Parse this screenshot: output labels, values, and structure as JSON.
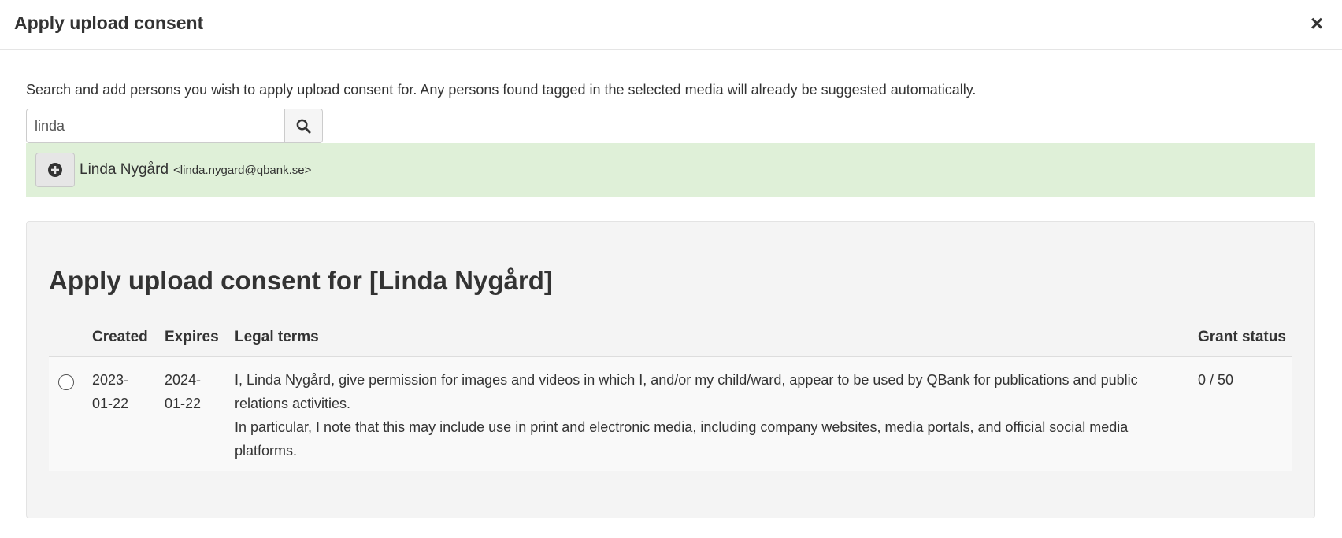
{
  "header": {
    "title": "Apply upload consent",
    "close_icon": "×"
  },
  "intro": "Search and add persons you wish to apply upload consent for. Any persons found tagged in the selected media will already be suggested automatically.",
  "search": {
    "value": "linda",
    "icon": "search-icon"
  },
  "result": {
    "name": "Linda Nygård",
    "email": "<linda.nygard@qbank.se>",
    "icon": "plus-circle-icon",
    "bg_color": "#dff0d8"
  },
  "consent": {
    "title": "Apply upload consent for [Linda Nygård]",
    "columns": {
      "created": "Created",
      "expires": "Expires",
      "legal": "Legal terms",
      "grant": "Grant status"
    },
    "rows": [
      {
        "created_line1": "2023-",
        "created_line2": "01-22",
        "expires_line1": "2024-",
        "expires_line2": "01-22",
        "legal_p1": "I, Linda Nygård, give permission for images and videos in which I, and/or my child/ward, appear to be used by QBank for publications and public relations activities.",
        "legal_p2": "In particular, I note that this may include use in print and electronic media, including company websites, media portals, and official social media platforms.",
        "grant": "0 / 50"
      }
    ]
  }
}
